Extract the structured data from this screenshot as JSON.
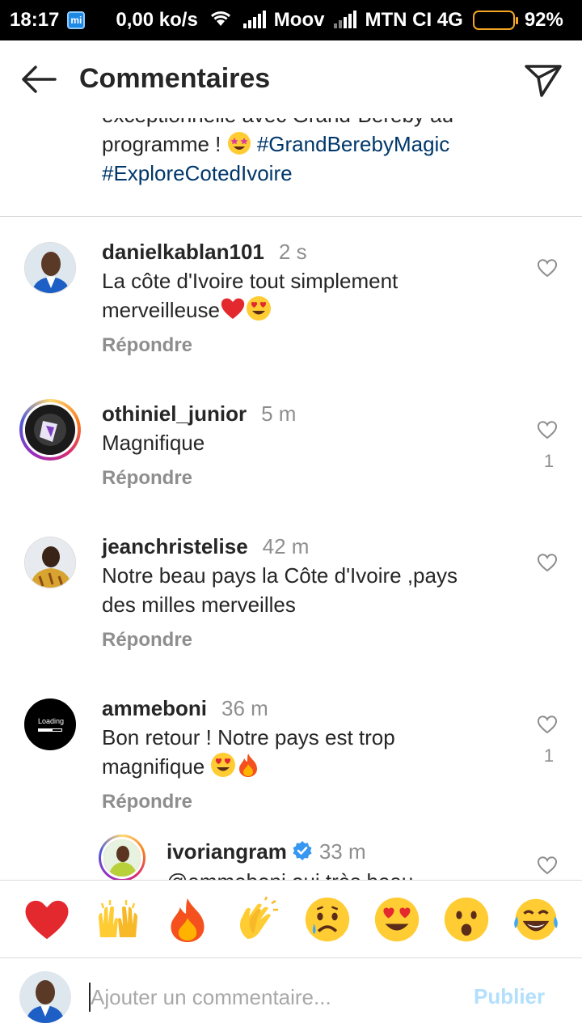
{
  "status_bar": {
    "time": "18:17",
    "speed": "0,00 ko/s",
    "carrier1": "Moov",
    "carrier2": "MTN CI 4G",
    "battery": "92%",
    "battery_level": 0.92
  },
  "header": {
    "title": "Commentaires"
  },
  "caption": {
    "line1": "exceptionnelle avec Grand-Bereby au",
    "line2_prefix": "programme ! ",
    "hashtag1": "#GrandBerebyMagic",
    "hashtag2": "#ExploreCotedIvoire"
  },
  "comments": [
    {
      "username": "danielkablan101",
      "time": "2 s",
      "line1": "La côte d'Ivoire tout simplement",
      "line2": "merveilleuse",
      "reply": "Répondre",
      "likes": ""
    },
    {
      "username": "othiniel_junior",
      "time": "5 m",
      "line1": "Magnifique",
      "line2": "",
      "reply": "Répondre",
      "likes": "1"
    },
    {
      "username": "jeanchristelise",
      "time": "42 m",
      "line1": "Notre beau pays la Côte d'Ivoire ,pays",
      "line2": "des milles merveilles",
      "reply": "Répondre",
      "likes": ""
    },
    {
      "username": "ammeboni",
      "time": "36 m",
      "line1": "Bon retour ! Notre pays est trop",
      "line2": "magnifique",
      "reply": "Répondre",
      "likes": "1",
      "avatar_text": "Loading"
    },
    {
      "username": "ivoriangram",
      "time": "33 m",
      "line1": "@ammeboni oui très beau",
      "line2": "",
      "reply": "",
      "likes": ""
    }
  ],
  "emoji_bar": [
    "red-heart",
    "raising-hands",
    "fire",
    "clapping-hands",
    "sad-face",
    "heart-eyes",
    "surprised-face",
    "tears-of-joy"
  ],
  "composer": {
    "placeholder": "Ajouter un commentaire...",
    "publish_label": "Publier"
  },
  "colors": {
    "text": "#262626",
    "secondary": "#8e8e8e",
    "hashtag": "#00376b",
    "verified": "#3897f0",
    "publish_disabled": "#b2dffc",
    "battery": "#f5a623"
  }
}
